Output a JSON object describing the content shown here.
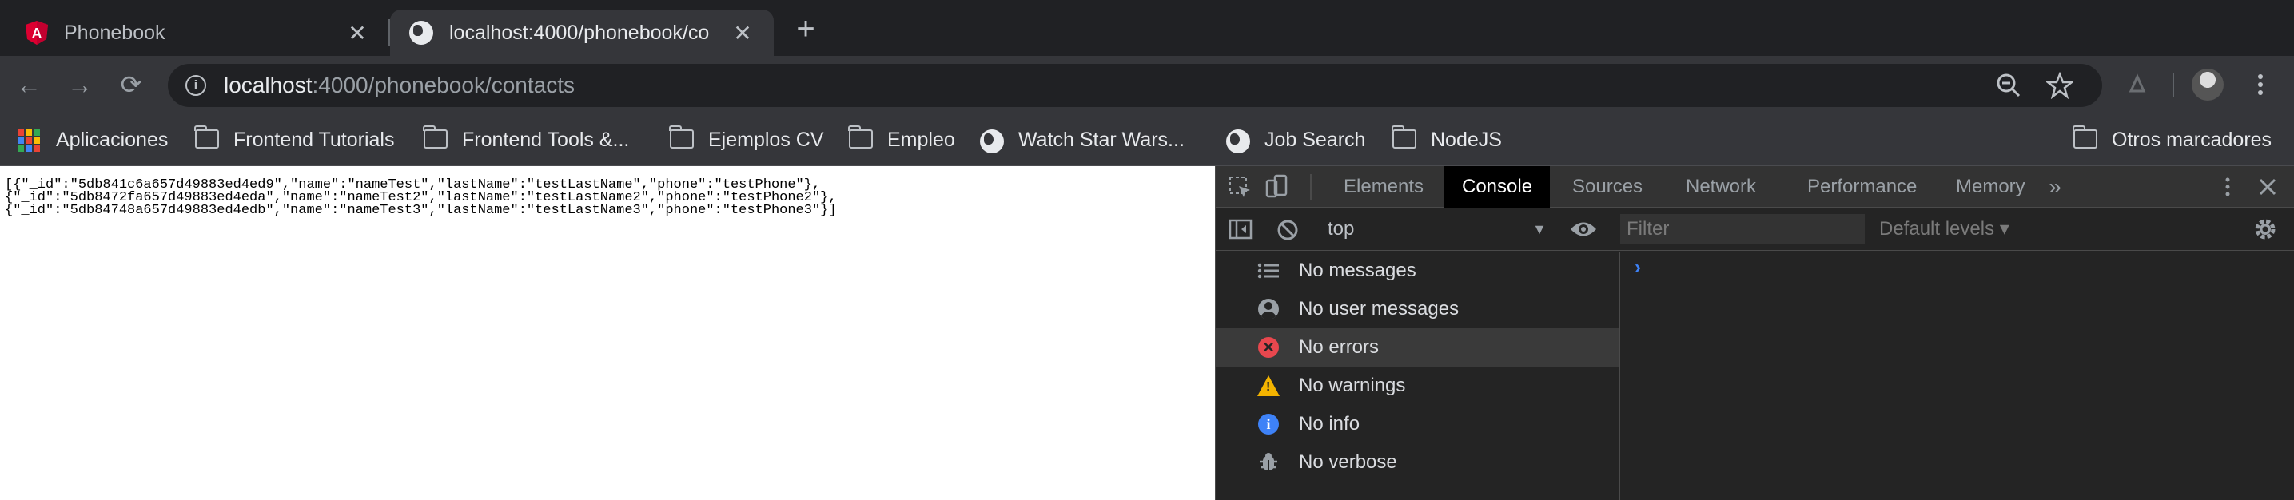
{
  "tabs": [
    {
      "title": "Phonebook",
      "icon": "angular-icon",
      "close": "✕"
    },
    {
      "title": "localhost:4000/phonebook/co",
      "icon": "globe-icon",
      "close": "✕"
    }
  ],
  "new_tab": "+",
  "nav": {
    "back": "←",
    "forward": "→",
    "reload": "⟳"
  },
  "omnibox": {
    "host": "localhost",
    "path": ":4000/phonebook/contacts",
    "info": "i"
  },
  "bookmarks": [
    {
      "label": "Aplicaciones",
      "icon": "apps-icon"
    },
    {
      "label": "Frontend Tutorials",
      "icon": "folder-icon"
    },
    {
      "label": "Frontend Tools &...",
      "icon": "folder-icon"
    },
    {
      "label": "Ejemplos CV",
      "icon": "folder-icon"
    },
    {
      "label": "Empleo",
      "icon": "folder-icon"
    },
    {
      "label": "Watch Star Wars...",
      "icon": "globe-icon"
    },
    {
      "label": "Job Search",
      "icon": "globe-icon"
    },
    {
      "label": "NodeJS",
      "icon": "folder-icon"
    },
    {
      "label": "Otros marcadores",
      "icon": "folder-icon"
    }
  ],
  "page": {
    "json_lines": [
      "[{\"_id\":\"5db841c6a657d49883ed4ed9\",\"name\":\"nameTest\",\"lastName\":\"testLastName\",\"phone\":\"testPhone\"},",
      "{\"_id\":\"5db8472fa657d49883ed4eda\",\"name\":\"nameTest2\",\"lastName\":\"testLastName2\",\"phone\":\"testPhone2\"},",
      "{\"_id\":\"5db84748a657d49883ed4edb\",\"name\":\"nameTest3\",\"lastName\":\"testLastName3\",\"phone\":\"testPhone3\"}]"
    ]
  },
  "devtools": {
    "tabs": [
      "Elements",
      "Console",
      "Sources",
      "Network",
      "Performance",
      "Memory"
    ],
    "active_tab": "Console",
    "more": "»",
    "context": "top",
    "filter_placeholder": "Filter",
    "levels": "Default levels ▾",
    "sidebar": [
      {
        "label": "No messages",
        "icon": "list-icon"
      },
      {
        "label": "No user messages",
        "icon": "user-icon"
      },
      {
        "label": "No errors",
        "icon": "error-icon",
        "selected": true
      },
      {
        "label": "No warnings",
        "icon": "warning-icon"
      },
      {
        "label": "No info",
        "icon": "info-icon"
      },
      {
        "label": "No verbose",
        "icon": "verbose-icon"
      }
    ],
    "prompt": "›"
  },
  "colors": {
    "accent": "#3e82f7",
    "error": "#e8474e",
    "warning": "#f4b400",
    "angular": "#dd0031"
  }
}
